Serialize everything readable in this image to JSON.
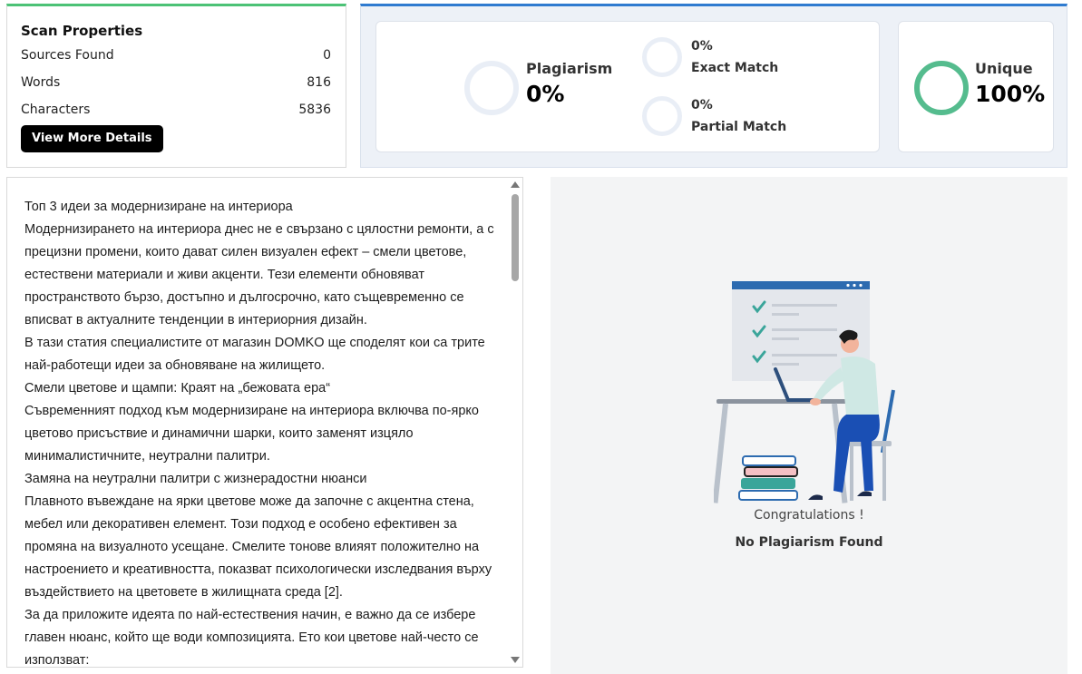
{
  "scan_properties": {
    "title": "Scan Properties",
    "rows": [
      {
        "label": "Sources Found",
        "value": "0"
      },
      {
        "label": "Words",
        "value": "816"
      },
      {
        "label": "Characters",
        "value": "5836"
      }
    ],
    "details_button": "View More Details"
  },
  "results": {
    "plagiarism": {
      "label": "Plagiarism",
      "value": "0%"
    },
    "exact_match": {
      "label": "Exact Match",
      "value": "0%"
    },
    "partial_match": {
      "label": "Partial Match",
      "value": "0%"
    },
    "unique": {
      "label": "Unique",
      "value": "100%"
    }
  },
  "text": {
    "paragraphs": [
      "Топ 3 идеи за модернизиране на интериора",
      "Модернизирането на интериора днес не е свързано с цялостни ремонти, а с прецизни промени, които дават силен визуален ефект – смели цветове, естествени материали и живи акценти. Тези елементи обновяват пространството бързо, достъпно и дългосрочно, като същевременно се вписват в актуалните тенденции в интериорния дизайн.",
      "В тази статия специалистите от магазин DOMKO ще споделят кои са трите най-работещи идеи за обновяване на жилището.",
      "Смели цветове и щампи: Краят на „бежовата ера“",
      "Съвременният подход към модернизиране на интериора включва по-ярко цветово присъствие и динамични шарки, които заменят изцяло минималистичните, неутрални палитри.",
      "Замяна на неутрални палитри с жизнерадостни нюанси",
      "Плавното въвеждане на ярки цветове може да започне с акцентна стена, мебел или декоративен елемент. Този подход е особено ефективен за промяна на визуалното усещане. Смелите тонове влияят положително на настроението и креативността, показват психологически изследвания върху въздействието на цветовете в жилищната среда [2].",
      "За да приложите идеята по най-естествения начин, е важно да се избере главен нюанс, който ще води композицията. Ето кои цветове най-често се използват:"
    ]
  },
  "result_message": {
    "congrats": "Congratulations !",
    "status": "No Plagiarism Found"
  },
  "colors": {
    "scan_accent": "#4cc276",
    "results_accent": "#2f7bd0",
    "unique_ring": "#55bc8e",
    "empty_ring": "#e9eef6"
  }
}
